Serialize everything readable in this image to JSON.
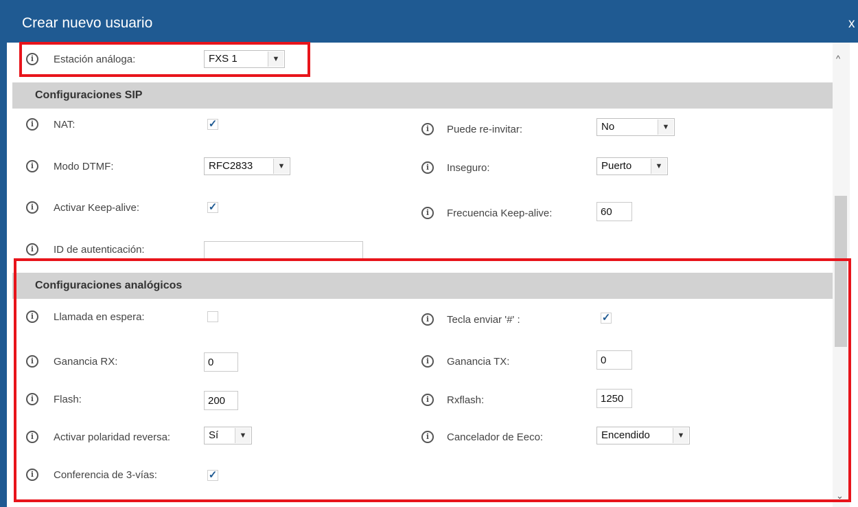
{
  "dialog": {
    "title": "Crear nuevo usuario",
    "close_label": "x"
  },
  "top": {
    "analog_station_label": "Estación análoga:",
    "analog_station_value": "FXS 1"
  },
  "sip": {
    "header": "Configuraciones SIP",
    "nat_label": "NAT:",
    "reinvite_label": "Puede re-invitar:",
    "reinvite_value": "No",
    "dtmf_label": "Modo DTMF:",
    "dtmf_value": "RFC2833",
    "insecure_label": "Inseguro:",
    "insecure_value": "Puerto",
    "keepalive_label": "Activar Keep-alive:",
    "keepalive_freq_label": "Frecuencia Keep-alive:",
    "keepalive_freq_value": "60",
    "auth_id_label": "ID de autenticación:",
    "auth_id_value": ""
  },
  "analog": {
    "header": "Configuraciones analógicos",
    "call_waiting_label": "Llamada en espera:",
    "send_hash_label": "Tecla enviar '#' :",
    "rx_gain_label": "Ganancia RX:",
    "rx_gain_value": "0",
    "tx_gain_label": "Ganancia TX:",
    "tx_gain_value": "0",
    "flash_label": "Flash:",
    "flash_value": "200",
    "rxflash_label": "Rxflash:",
    "rxflash_value": "1250",
    "reverse_polarity_label": "Activar polaridad reversa:",
    "reverse_polarity_value": "Sí",
    "echo_canceller_label": "Cancelador de Eeco:",
    "echo_canceller_value": "Encendido",
    "three_way_label": "Conferencia de 3-vías:"
  },
  "checks": {
    "nat": true,
    "keepalive": true,
    "call_waiting": false,
    "send_hash": true,
    "three_way": true
  },
  "icons": {
    "info": "info-icon",
    "dropdown": "chevron-down-icon",
    "check": "check-icon"
  },
  "colors": {
    "titlebar": "#1f5a92",
    "section": "#d2d2d2",
    "highlight": "#e8141b"
  }
}
